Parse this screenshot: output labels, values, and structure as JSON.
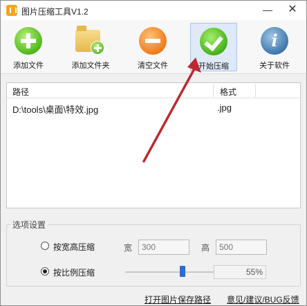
{
  "window": {
    "title": "图片压缩工具V1.2",
    "minimize_glyph": "—",
    "close_glyph": "✕"
  },
  "toolbar": {
    "items": [
      {
        "label": "添加文件",
        "icon": "add-file-icon",
        "active": false
      },
      {
        "label": "添加文件夹",
        "icon": "add-folder-icon",
        "active": false
      },
      {
        "label": "清空文件",
        "icon": "clear-files-icon",
        "active": false
      },
      {
        "label": "开始压缩",
        "icon": "start-compress-icon",
        "active": true
      },
      {
        "label": "关于软件",
        "icon": "about-icon",
        "active": false
      }
    ],
    "about_glyph": "i"
  },
  "file_list": {
    "columns": [
      "路径",
      "格式"
    ],
    "rows": [
      {
        "path": "D:\\tools\\桌面\\特效.jpg",
        "format": ".jpg"
      }
    ]
  },
  "options": {
    "group_title": "选项设置",
    "mode_size_label": "按宽高压缩",
    "mode_ratio_label": "按比例压缩",
    "selected_mode": "按比例压缩",
    "width_label": "宽",
    "width_value": "300",
    "height_label": "高",
    "height_value": "500",
    "ratio_value": "55%",
    "ratio_fraction": 0.55
  },
  "footer": {
    "open_folder_link": "打开图片保存路径",
    "feedback_link": "意见/建议/BUG反馈"
  },
  "annotation": {
    "arrow_color": "#c0282e"
  }
}
